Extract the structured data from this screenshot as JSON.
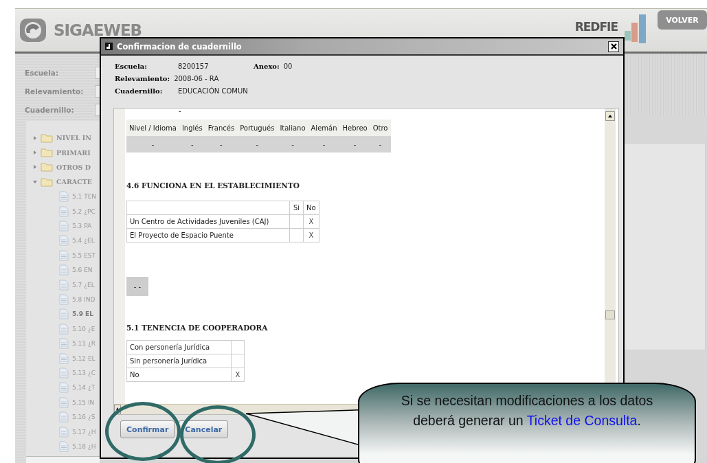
{
  "header": {
    "logo": "SIGAEWEB",
    "brand": "REDFIE",
    "back_button": "VOLVER"
  },
  "filters": [
    {
      "label": "Escuela:"
    },
    {
      "label": "Relevamiento:"
    },
    {
      "label": "Cuadernillo:"
    }
  ],
  "tree": [
    {
      "kind": "folder",
      "label": "NIVEL IN",
      "expanded": false
    },
    {
      "kind": "folder",
      "label": "PRIMARI",
      "expanded": false
    },
    {
      "kind": "folder",
      "label": "OTROS D",
      "expanded": false
    },
    {
      "kind": "folder",
      "label": "CARACTE",
      "expanded": true,
      "children": [
        {
          "kind": "page",
          "label": "5.1 TEN",
          "selected": false
        },
        {
          "kind": "page",
          "label": "5.2 ¿PC",
          "selected": false
        },
        {
          "kind": "page",
          "label": "5.3 PA",
          "selected": false
        },
        {
          "kind": "page",
          "label": "5.4 ¿EL",
          "selected": false
        },
        {
          "kind": "page",
          "label": "5.5 EST",
          "selected": false
        },
        {
          "kind": "page",
          "label": "5.6 EN",
          "selected": false
        },
        {
          "kind": "page",
          "label": "5.7 ¿EL",
          "selected": false
        },
        {
          "kind": "page",
          "label": "5.8 IND",
          "selected": false
        },
        {
          "kind": "page",
          "label": "5.9 EL",
          "selected": true
        },
        {
          "kind": "page",
          "label": "5.10 ¿E",
          "selected": false
        },
        {
          "kind": "page",
          "label": "5.11 ¿R",
          "selected": false
        },
        {
          "kind": "page",
          "label": "5.12 EL",
          "selected": false
        },
        {
          "kind": "page",
          "label": "5.13 ¿C",
          "selected": false
        },
        {
          "kind": "page",
          "label": "5.14 ¿T",
          "selected": false
        },
        {
          "kind": "page",
          "label": "5.15 IN",
          "selected": false
        },
        {
          "kind": "page",
          "label": "5.16 ¿S",
          "selected": false
        },
        {
          "kind": "page",
          "label": "5.17 ¿H",
          "selected": false
        },
        {
          "kind": "page",
          "label": "5.18 ¿H",
          "selected": false
        }
      ]
    }
  ],
  "dialog": {
    "title": "Confirmacion de cuadernillo",
    "info": {
      "escuela_label": "Escuela:",
      "escuela": "8200157",
      "anexo_label": "Anexo:",
      "anexo": "00",
      "relevamiento_label": "Relevamiento:",
      "relevamiento": "2008-06 - RA",
      "cuadernillo_label": "Cuadernillo:",
      "cuadernillo": "EDUCACIÓN COMUN"
    },
    "top_dash": "-",
    "languages": {
      "columns": [
        "Nivel / Idioma",
        "Inglés",
        "Francés",
        "Portugués",
        "Italiano",
        "Alemán",
        "Hebreo",
        "Otro"
      ],
      "values": [
        "-",
        "-",
        "-",
        "-",
        "-",
        "-",
        "-",
        "-"
      ]
    },
    "section_1": {
      "title": "4.6 FUNCIONA EN EL ESTABLECIMIENTO",
      "columns": [
        "Si",
        "No"
      ],
      "rows": [
        {
          "label": "Un Centro de Actividades Juveniles (CAJ)",
          "no": "X"
        },
        {
          "label": "El Proyecto de Espacio Puente",
          "no": "X"
        }
      ]
    },
    "gray_box": "- -",
    "section_2": {
      "title": "5.1 TENENCIA DE COOPERADORA",
      "rows": [
        {
          "label": "Con personería Jurídica"
        },
        {
          "label": "Sin personería Jurídica"
        },
        {
          "label": "No",
          "value": "X"
        }
      ]
    },
    "buttons": [
      "Confirmar",
      "Cancelar"
    ]
  },
  "callout": {
    "text": "Si se necesitan modificaciones a los datos deberá generar un",
    "link": "Ticket de Consulta",
    "text_after": "."
  }
}
